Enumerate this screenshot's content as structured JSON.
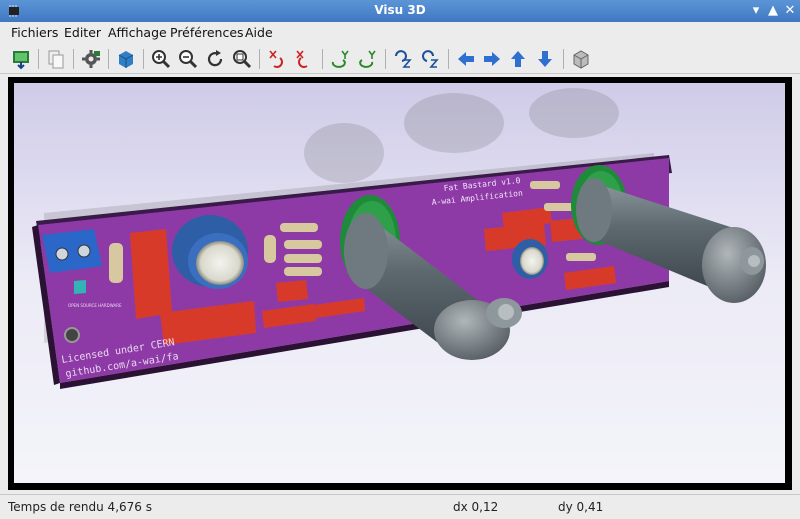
{
  "window": {
    "title": "Visu 3D"
  },
  "menu": [
    "Fichiers",
    "Editer",
    "Affichage",
    "Préférences",
    "Aide"
  ],
  "toolbar": {
    "buttons": [
      "export-image",
      "copy-clipboard",
      "settings",
      "3d-view-box",
      "zoom-in",
      "zoom-out",
      "refresh",
      "zoom-fit",
      "rotate-x-cw",
      "rotate-x-ccw",
      "rotate-y-cw",
      "rotate-y-ccw",
      "rotate-z-cw",
      "rotate-z-ccw",
      "move-left",
      "move-right",
      "move-up",
      "move-down",
      "ortho-view"
    ]
  },
  "board": {
    "title_line1": "Fat Bastard v1.0",
    "title_line2": "A-wai Amplification",
    "license_line1": "Licensed under CERN",
    "license_line2": "github.com/a-wai/fa",
    "logo_text": "OPEN SOURCE HARDWARE"
  },
  "status": {
    "render_time": "Temps de rendu 4,676 s",
    "dx": "dx 0,12",
    "dy": "dy 0,41"
  }
}
